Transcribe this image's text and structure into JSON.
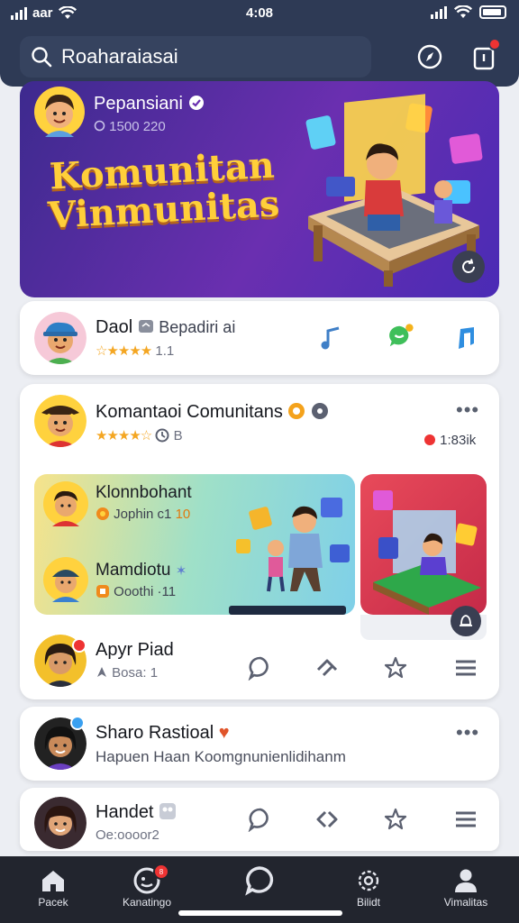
{
  "status_bar": {
    "carrier": "aar",
    "time": "4:08"
  },
  "search": {
    "placeholder": "Roaharaiasai",
    "icon": "search-icon"
  },
  "header_icons": [
    "compass-icon",
    "notification-icon"
  ],
  "hero": {
    "user_name": "Pepansiani",
    "verified": true,
    "subtitle": "1500 220",
    "title_line1": "Komunitan",
    "title_line2": "Vinmunitas"
  },
  "card1": {
    "name": "Daol",
    "tag": "Bepadiri ai",
    "rating": "1.1",
    "actions": [
      "music-note-icon",
      "chat-bubble-icon",
      "music-icon"
    ]
  },
  "card2": {
    "name": "Komantaoi Comunitans",
    "meta": "B",
    "rating_count": "1:83ik",
    "tile1": {
      "person1_name": "Klonnbohant",
      "person1_sub": "Jophin c1 ",
      "person1_count": "10",
      "person2_name": "Mamdiotu",
      "person2_sub": "Ooothi ·11"
    },
    "post": {
      "name": "Apyr Piad",
      "sub": "Bosa: 1",
      "actions": [
        "comment-icon",
        "share-icon",
        "star-icon",
        "menu-icon"
      ]
    }
  },
  "card3": {
    "name": "Sharo Rastioal",
    "sub": "Hapuen Haan Koomgnunienlidihanm"
  },
  "card4": {
    "name": "Handet",
    "sub": "Oe:oooor2",
    "actions": [
      "comment-icon",
      "share-icon",
      "star-icon",
      "menu-icon"
    ]
  },
  "bottom_nav": [
    {
      "label": "Pacek",
      "icon": "home-icon"
    },
    {
      "label": "Kanatingo",
      "icon": "face-icon",
      "badge": "8"
    },
    {
      "label": "",
      "icon": "chat-icon"
    },
    {
      "label": "Bilidt",
      "icon": "settings-icon"
    },
    {
      "label": "Vimalitas",
      "icon": "profile-icon"
    }
  ],
  "colors": {
    "header": "#2e3a55",
    "accent_gold": "#ffcf3a",
    "badge": "#e33333",
    "nav": "#22252e"
  }
}
